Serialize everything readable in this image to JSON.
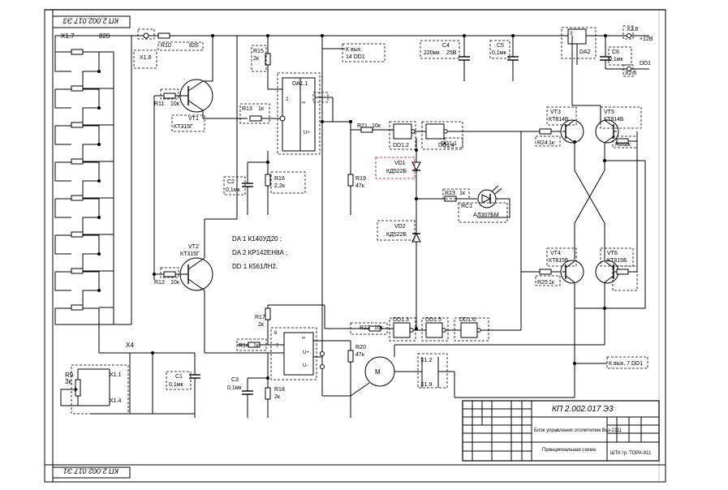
{
  "sheet": {
    "stamp_top": "КП 2.002.017 Э3",
    "stamp_bottom": "КП 2.002.017 Э1",
    "designation": "КП 2.002.017 Э3",
    "product_name": "Блок управления отопителем Ваз-2111",
    "doc_name": "Принципиальная схема",
    "org": "ШТК гр. ТОРА-911"
  },
  "notes": {
    "line1": "DA 1 К140УД20 ;",
    "line2": "DA 2 КР142ЕН8А ;",
    "line3": "DD 1 К561ЛН2."
  },
  "labels": {
    "x1_top": "X1.7",
    "x1_8": "X1.8",
    "x1_1": "X1.1",
    "x1_4": "X1.4",
    "x1_2": "X1.2",
    "x1_9": "X1.9",
    "x4": "X4",
    "x2_6": "X2.6",
    "x2_5": "X2.5",
    "vyh_dd1": "К вых.",
    "vyh_dd1_b": "14 DD1",
    "vyh_7": "К вых. 7 DD1",
    "to_12v": "+12В",
    "dd1": "DD1",
    "r10": "R10",
    "r10v": "820",
    "r11": "R11",
    "r11v": "10к",
    "r12": "R12",
    "r12v": "10к",
    "r13": "R13",
    "r13v": "1к",
    "r14": "R14",
    "r14v": "1к",
    "r15": "R15",
    "r15v": "2к",
    "r16": "R16",
    "r16v": "2,2к",
    "r17": "R17",
    "r17v": "2к",
    "r18": "R18",
    "r18v": "2к",
    "r19": "R19",
    "r19v": "47к",
    "r20": "R20",
    "r20v": "47к",
    "r21": "R21",
    "r21v": "10к",
    "r22": "R22",
    "r22v": "10к",
    "r23": "R23",
    "r23v": "1к",
    "r24": "R24",
    "r24v": "1к",
    "r25": "R25",
    "r25v": "1к",
    "r26": "R26",
    "r26v": "1к",
    "r9": "R9",
    "r9v": "3к",
    "c1": "С1",
    "c1v": "0,1мк",
    "c2": "С2",
    "c2v": "0,1мк",
    "c3": "С3",
    "c3v": "0,1мк",
    "c4": "С4",
    "c4v": "220мк",
    "c4v2": "25В",
    "c5": "С5",
    "c5v": "0,1мк",
    "c6": "С6",
    "c6v": "0,1мк",
    "vt1": "VT1",
    "vt1v": "КТ315Г",
    "vt2": "VT2",
    "vt2v": "КТ315Г",
    "vt3": "VT3",
    "vt3v": "КТ814Б",
    "vt4": "VT4",
    "vt4v": "КТ815Б",
    "vt5": "VT5",
    "vt5v": "КТ814Б",
    "vt6": "VT6",
    "vt6v": "КТ815Б",
    "vd1": "VD1",
    "vd1v": "КД522Б",
    "vd2": "VD2",
    "vd2v": "КД522Б",
    "rc1": "RC1",
    "rc1v": "АЛ307БМ",
    "da1": "DA1.1",
    "da2": "DA2",
    "dd1_1": "DD1.1",
    "dd1_2": "DD1.2",
    "dd1_3": "DD1.3",
    "dd1_4": "DD1.4",
    "dd1_5": "DD1.5",
    "dd1_6": "DD1.6",
    "pin6": "6",
    "pin7": "7",
    "pin3": "3",
    "pin2": "2",
    "m": "M",
    "inf": "∞",
    "uplus": "U+",
    "uminus": "U-",
    "vyh": "Вых.",
    "vyh2": "Вых."
  }
}
